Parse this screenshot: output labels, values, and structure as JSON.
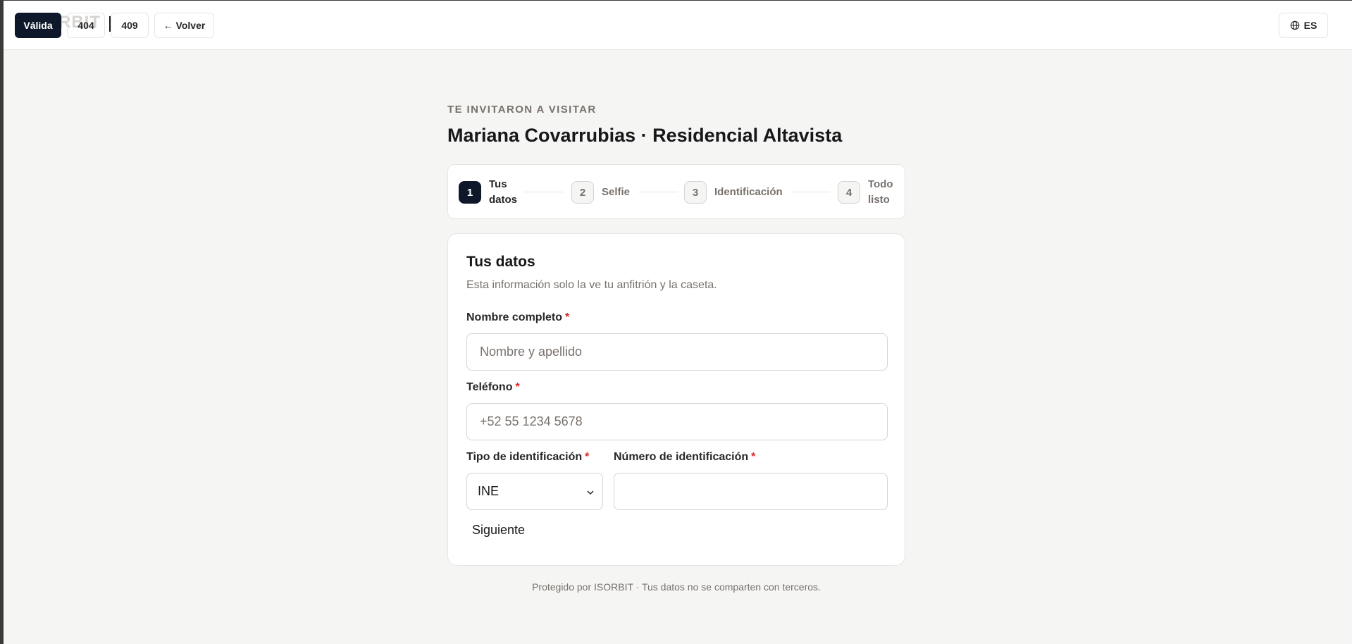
{
  "topbar": {
    "logo_ghost": "RBIT",
    "pills": [
      {
        "label": "Válida",
        "active": true
      },
      {
        "label": "404",
        "active": false
      },
      {
        "label": "409",
        "active": false
      }
    ],
    "back_label": "← Volver",
    "language": "ES"
  },
  "header": {
    "eyebrow": "TE INVITARON A VISITAR",
    "title": "Mariana Covarrubias · Residencial Altavista"
  },
  "stepper": {
    "steps": [
      {
        "num": "1",
        "label": "Tus datos",
        "current": true
      },
      {
        "num": "2",
        "label": "Selfie",
        "current": false
      },
      {
        "num": "3",
        "label": "Identificación",
        "current": false
      },
      {
        "num": "4",
        "label": "Todo listo",
        "current": false
      }
    ]
  },
  "form": {
    "title": "Tus datos",
    "subtitle": "Esta información solo la ve tu anfitrión y la caseta.",
    "required_mark": "*",
    "name_label": "Nombre completo",
    "name_placeholder": "Nombre y apellido",
    "name_value": "",
    "phone_label": "Teléfono",
    "phone_placeholder": "+52 55 1234 5678",
    "phone_value": "",
    "id_type_label": "Tipo de identificación",
    "id_type_value": "INE",
    "id_number_label": "Número de identificación",
    "id_number_value": "",
    "next_label": "Siguiente"
  },
  "footer": {
    "text": "Protegido por ISORBIT · Tus datos no se comparten con terceros."
  },
  "colors": {
    "primary": "#0f172a",
    "required": "#dc2626",
    "muted": "#78716c",
    "background": "#f5f5f4"
  }
}
